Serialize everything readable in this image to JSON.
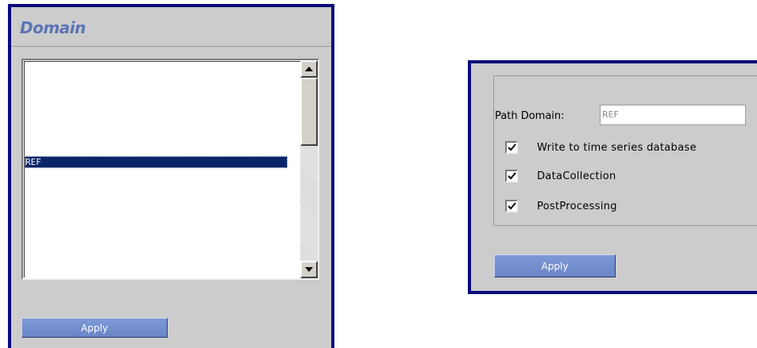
{
  "domain_panel": {
    "title": "Domain",
    "list_items": [
      "REF"
    ],
    "selected_item": "REF",
    "apply_label": "Apply"
  },
  "settings_panel": {
    "path_label": "Path",
    "domain_label": "Domain:",
    "domain_value": "REF",
    "checkboxes": [
      {
        "label": "Write to time series database",
        "checked": true
      },
      {
        "label": "DataCollection",
        "checked": true
      },
      {
        "label": "PostProcessing",
        "checked": true
      }
    ],
    "apply_label": "Apply"
  },
  "colors": {
    "panel_border": "#0a0a7c",
    "panel_bg": "#cccccc",
    "title": "#5c74b6",
    "selection": "#0a246a",
    "button": "#7e99d6"
  }
}
